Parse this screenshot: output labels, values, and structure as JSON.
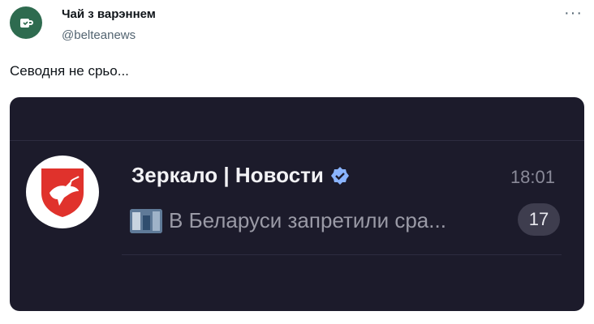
{
  "tweet": {
    "author_name": "Чай з варэннем",
    "author_handle": "@belteanews",
    "more_label": "···",
    "text": "Севодня не срьо..."
  },
  "screenshot": {
    "chat_title": "Зеркало | Новости",
    "time": "18:01",
    "preview_text": "В Беларуси запретили сра...",
    "unread_count": "17",
    "icons": [
      "teacup-icon",
      "dove-shield-icon",
      "verified-badge-icon",
      "news-thumbnail-icon"
    ],
    "colors": {
      "background": "#1c1b2b",
      "verified": "#8ab4ff",
      "logo_red": "#e0322c",
      "badge_bg": "#3e3d4e"
    }
  }
}
